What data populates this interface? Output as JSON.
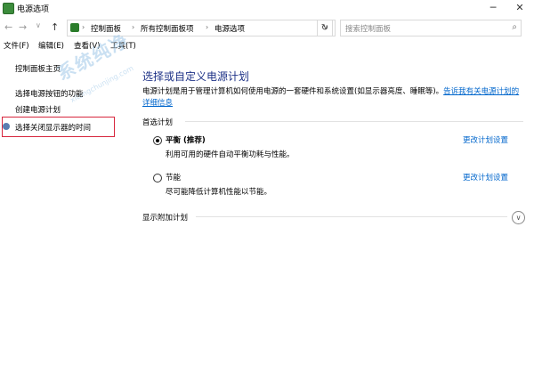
{
  "window": {
    "title": "电源选项",
    "minimize": "─",
    "close": "✕"
  },
  "address": {
    "nav": {
      "back": "←",
      "forward": "→",
      "history": "∨",
      "up": "↑"
    },
    "crumbs": [
      "控制面板",
      "所有控制面板项",
      "电源选项"
    ],
    "separator": "›",
    "dropdown": "∨",
    "refresh": "↻",
    "search_placeholder": "搜索控制面板",
    "search_icon": "⌕"
  },
  "menu": [
    "文件(F)",
    "编辑(E)",
    "查看(V)",
    "工具(T)"
  ],
  "sidebar": {
    "items": [
      "控制面板主页",
      "选择电源按钮的功能",
      "创建电源计划",
      "选择关闭显示器的时间"
    ]
  },
  "watermark": {
    "main": "系统纯净",
    "sub": "xitongchunjing.com"
  },
  "main": {
    "title": "选择或自定义电源计划",
    "description": "电源计划是用于管理计算机如何使用电源的一套硬件和系统设置(如显示器亮度、睡眠等)。",
    "description_link": "告诉我有关电源计划的详细信息",
    "preferred_label": "首选计划",
    "plans": [
      {
        "name": "平衡 (推荐)",
        "desc": "利用可用的硬件自动平衡功耗与性能。",
        "link": "更改计划设置",
        "selected": true
      },
      {
        "name": "节能",
        "desc": "尽可能降低计算机性能以节能。",
        "link": "更改计划设置",
        "selected": false
      }
    ],
    "additional_label": "显示附加计划",
    "expand_icon": "∨"
  },
  "colors": {
    "title": "#1e3287",
    "link": "#0066cc",
    "highlight": "#d7263d"
  }
}
